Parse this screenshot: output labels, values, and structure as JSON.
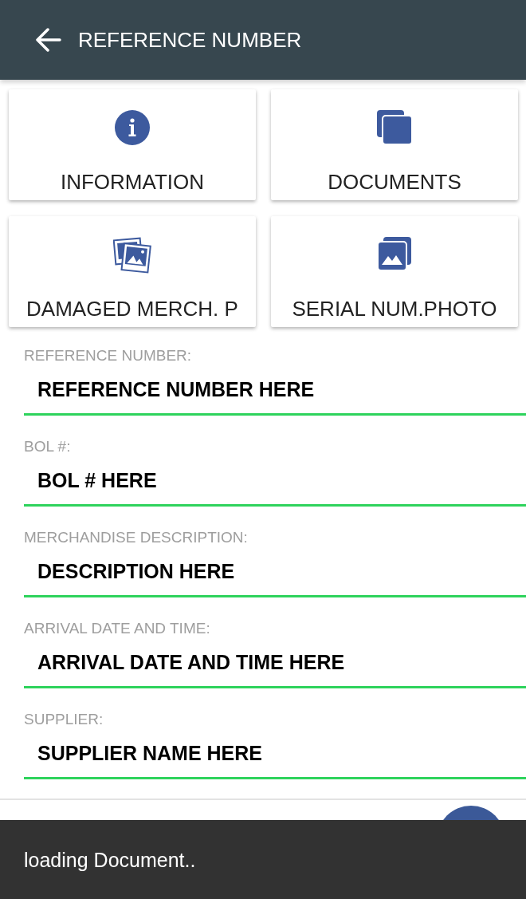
{
  "app_bar": {
    "title": "REFERENCE NUMBER"
  },
  "tiles": [
    {
      "label": "INFORMATION",
      "kind": "info"
    },
    {
      "label": "DOCUMENTS",
      "kind": "documents"
    },
    {
      "label": "DAMAGED MERCH. P",
      "kind": "photos"
    },
    {
      "label": "SERIAL NUM.PHOTO",
      "kind": "gallery"
    }
  ],
  "fields": [
    {
      "label": "REFERENCE NUMBER:",
      "value": "REFERENCE NUMBER HERE"
    },
    {
      "label": "BOL #:",
      "value": "BOL # HERE"
    },
    {
      "label": "MERCHANDISE DESCRIPTION:",
      "value": "DESCRIPTION HERE"
    },
    {
      "label": "ARRIVAL DATE AND TIME:",
      "value": "ARRIVAL DATE AND TIME HERE"
    },
    {
      "label": "SUPPLIER:",
      "value": "SUPPLIER NAME HERE"
    }
  ],
  "snackbar": {
    "message": "loading Document.."
  }
}
